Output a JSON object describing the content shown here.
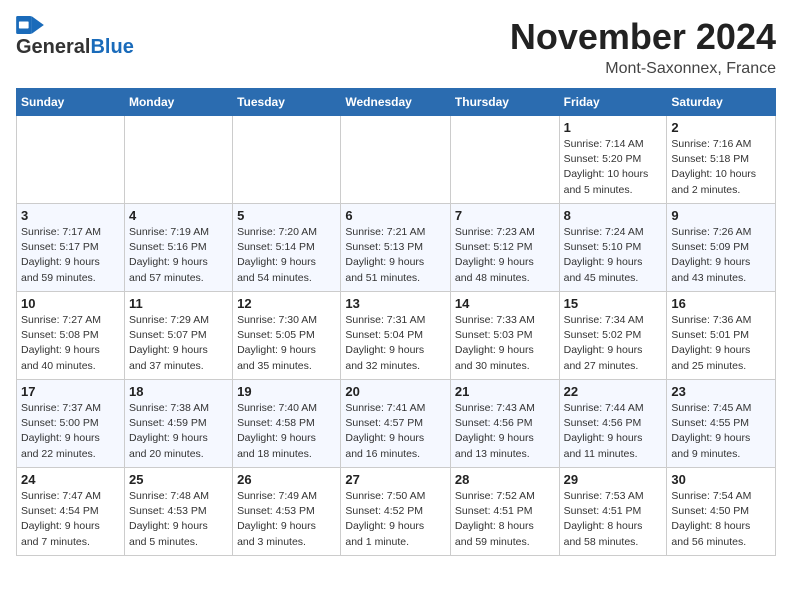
{
  "header": {
    "logo_line1": "General",
    "logo_line2": "Blue",
    "month": "November 2024",
    "location": "Mont-Saxonnex, France"
  },
  "weekdays": [
    "Sunday",
    "Monday",
    "Tuesday",
    "Wednesday",
    "Thursday",
    "Friday",
    "Saturday"
  ],
  "weeks": [
    [
      {
        "day": "",
        "info": ""
      },
      {
        "day": "",
        "info": ""
      },
      {
        "day": "",
        "info": ""
      },
      {
        "day": "",
        "info": ""
      },
      {
        "day": "",
        "info": ""
      },
      {
        "day": "1",
        "info": "Sunrise: 7:14 AM\nSunset: 5:20 PM\nDaylight: 10 hours\nand 5 minutes."
      },
      {
        "day": "2",
        "info": "Sunrise: 7:16 AM\nSunset: 5:18 PM\nDaylight: 10 hours\nand 2 minutes."
      }
    ],
    [
      {
        "day": "3",
        "info": "Sunrise: 7:17 AM\nSunset: 5:17 PM\nDaylight: 9 hours\nand 59 minutes."
      },
      {
        "day": "4",
        "info": "Sunrise: 7:19 AM\nSunset: 5:16 PM\nDaylight: 9 hours\nand 57 minutes."
      },
      {
        "day": "5",
        "info": "Sunrise: 7:20 AM\nSunset: 5:14 PM\nDaylight: 9 hours\nand 54 minutes."
      },
      {
        "day": "6",
        "info": "Sunrise: 7:21 AM\nSunset: 5:13 PM\nDaylight: 9 hours\nand 51 minutes."
      },
      {
        "day": "7",
        "info": "Sunrise: 7:23 AM\nSunset: 5:12 PM\nDaylight: 9 hours\nand 48 minutes."
      },
      {
        "day": "8",
        "info": "Sunrise: 7:24 AM\nSunset: 5:10 PM\nDaylight: 9 hours\nand 45 minutes."
      },
      {
        "day": "9",
        "info": "Sunrise: 7:26 AM\nSunset: 5:09 PM\nDaylight: 9 hours\nand 43 minutes."
      }
    ],
    [
      {
        "day": "10",
        "info": "Sunrise: 7:27 AM\nSunset: 5:08 PM\nDaylight: 9 hours\nand 40 minutes."
      },
      {
        "day": "11",
        "info": "Sunrise: 7:29 AM\nSunset: 5:07 PM\nDaylight: 9 hours\nand 37 minutes."
      },
      {
        "day": "12",
        "info": "Sunrise: 7:30 AM\nSunset: 5:05 PM\nDaylight: 9 hours\nand 35 minutes."
      },
      {
        "day": "13",
        "info": "Sunrise: 7:31 AM\nSunset: 5:04 PM\nDaylight: 9 hours\nand 32 minutes."
      },
      {
        "day": "14",
        "info": "Sunrise: 7:33 AM\nSunset: 5:03 PM\nDaylight: 9 hours\nand 30 minutes."
      },
      {
        "day": "15",
        "info": "Sunrise: 7:34 AM\nSunset: 5:02 PM\nDaylight: 9 hours\nand 27 minutes."
      },
      {
        "day": "16",
        "info": "Sunrise: 7:36 AM\nSunset: 5:01 PM\nDaylight: 9 hours\nand 25 minutes."
      }
    ],
    [
      {
        "day": "17",
        "info": "Sunrise: 7:37 AM\nSunset: 5:00 PM\nDaylight: 9 hours\nand 22 minutes."
      },
      {
        "day": "18",
        "info": "Sunrise: 7:38 AM\nSunset: 4:59 PM\nDaylight: 9 hours\nand 20 minutes."
      },
      {
        "day": "19",
        "info": "Sunrise: 7:40 AM\nSunset: 4:58 PM\nDaylight: 9 hours\nand 18 minutes."
      },
      {
        "day": "20",
        "info": "Sunrise: 7:41 AM\nSunset: 4:57 PM\nDaylight: 9 hours\nand 16 minutes."
      },
      {
        "day": "21",
        "info": "Sunrise: 7:43 AM\nSunset: 4:56 PM\nDaylight: 9 hours\nand 13 minutes."
      },
      {
        "day": "22",
        "info": "Sunrise: 7:44 AM\nSunset: 4:56 PM\nDaylight: 9 hours\nand 11 minutes."
      },
      {
        "day": "23",
        "info": "Sunrise: 7:45 AM\nSunset: 4:55 PM\nDaylight: 9 hours\nand 9 minutes."
      }
    ],
    [
      {
        "day": "24",
        "info": "Sunrise: 7:47 AM\nSunset: 4:54 PM\nDaylight: 9 hours\nand 7 minutes."
      },
      {
        "day": "25",
        "info": "Sunrise: 7:48 AM\nSunset: 4:53 PM\nDaylight: 9 hours\nand 5 minutes."
      },
      {
        "day": "26",
        "info": "Sunrise: 7:49 AM\nSunset: 4:53 PM\nDaylight: 9 hours\nand 3 minutes."
      },
      {
        "day": "27",
        "info": "Sunrise: 7:50 AM\nSunset: 4:52 PM\nDaylight: 9 hours\nand 1 minute."
      },
      {
        "day": "28",
        "info": "Sunrise: 7:52 AM\nSunset: 4:51 PM\nDaylight: 8 hours\nand 59 minutes."
      },
      {
        "day": "29",
        "info": "Sunrise: 7:53 AM\nSunset: 4:51 PM\nDaylight: 8 hours\nand 58 minutes."
      },
      {
        "day": "30",
        "info": "Sunrise: 7:54 AM\nSunset: 4:50 PM\nDaylight: 8 hours\nand 56 minutes."
      }
    ]
  ]
}
